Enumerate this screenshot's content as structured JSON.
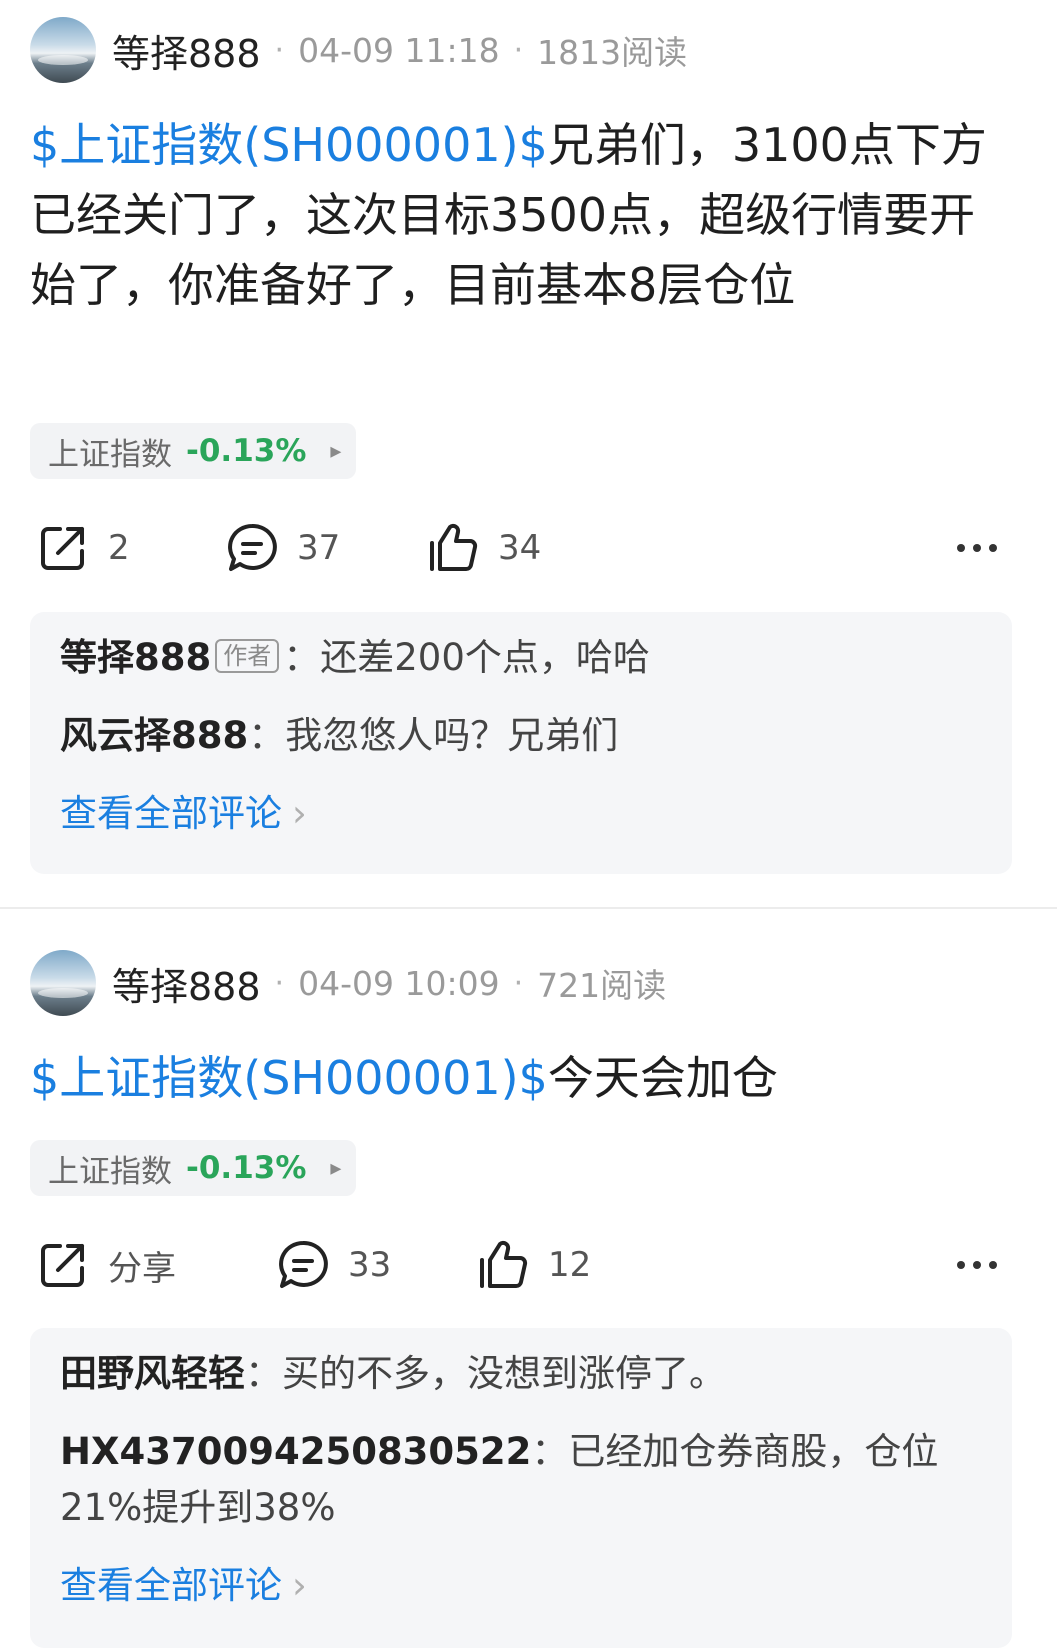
{
  "posts": [
    {
      "username": "等择888",
      "time": "04-09 11:18",
      "reads": "1813阅读",
      "stock_link": "$上证指数(SH000001)$",
      "text": "兄弟们，3100点下方已经关门了，这次目标3500点，超级行情要开始了，你准备好了，目前基本8层仓位",
      "chip": {
        "name": "上证指数",
        "change": "-0.13%"
      },
      "actions": {
        "share": "2",
        "comments": "37",
        "likes": "34"
      },
      "comments": [
        {
          "author": "等择888",
          "tag": "作者",
          "text": "还差200个点，哈哈"
        },
        {
          "author": "风云择888",
          "tag": "",
          "text": "我忽悠人吗？兄弟们"
        }
      ],
      "view_all": "查看全部评论"
    },
    {
      "username": "等择888",
      "time": "04-09 10:09",
      "reads": "721阅读",
      "stock_link": "$上证指数(SH000001)$",
      "text": "今天会加仓",
      "chip": {
        "name": "上证指数",
        "change": "-0.13%"
      },
      "actions": {
        "share": "分享",
        "comments": "33",
        "likes": "12"
      },
      "comments": [
        {
          "author": "田野风轻轻",
          "tag": "",
          "text": "买的不多，没想到涨停了。"
        },
        {
          "author": "HX4370094250830522",
          "tag": "",
          "text": "已经加仓券商股，仓位21%提升到38%"
        }
      ],
      "view_all": "查看全部评论"
    }
  ],
  "colors": {
    "link": "#1a7fe0",
    "down": "#2aa55a",
    "panel": "#f5f6f8"
  },
  "icons": [
    "share-icon",
    "comment-icon",
    "like-icon",
    "more-icon",
    "chevron-right-icon"
  ]
}
